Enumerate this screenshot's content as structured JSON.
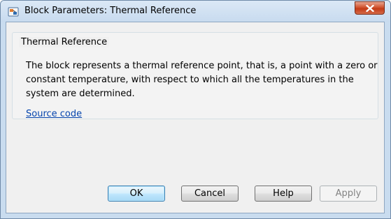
{
  "window": {
    "title": "Block Parameters: Thermal Reference",
    "icon": "simulink-block-icon",
    "close_icon": "close-icon"
  },
  "group": {
    "title": "Thermal Reference",
    "description": "The block represents a thermal reference point, that is, a point with a zero or constant temperature, with respect to which all the temperatures in the system are determined.",
    "link_label": "Source code"
  },
  "buttons": {
    "ok": "OK",
    "cancel": "Cancel",
    "help": "Help",
    "apply": "Apply"
  },
  "colors": {
    "link": "#0645ad",
    "close_button": "#c43b17",
    "frame": "#c9dcef"
  }
}
